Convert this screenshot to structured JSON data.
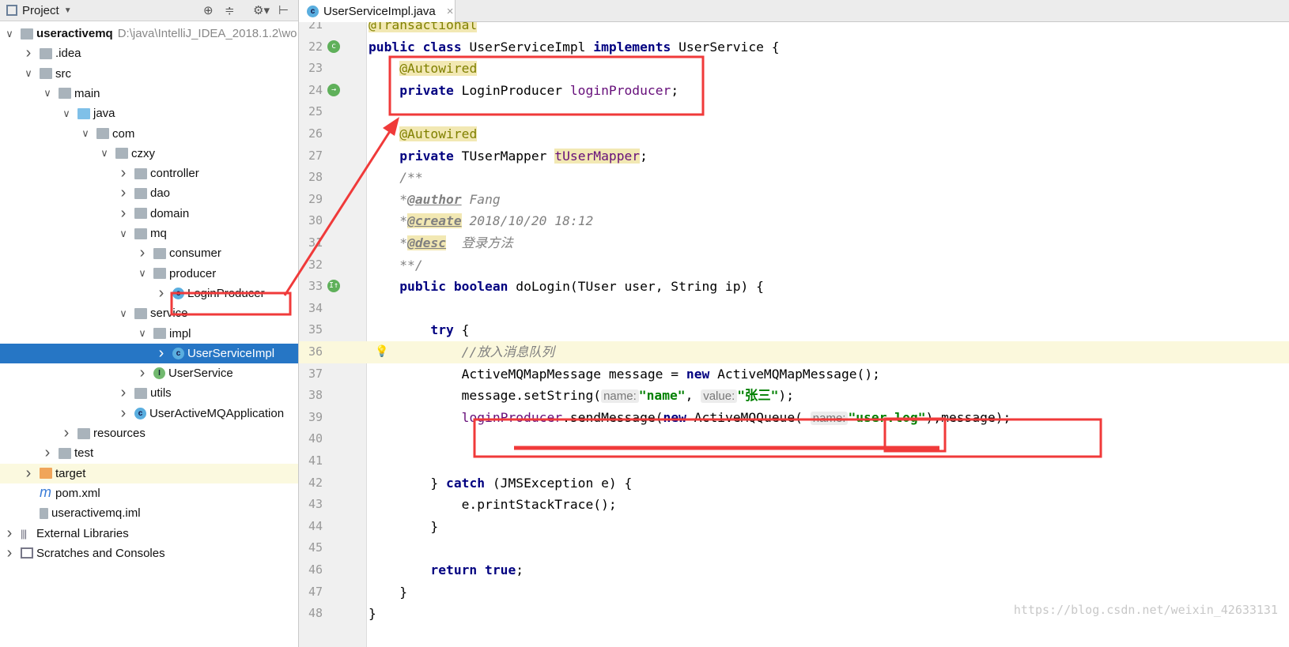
{
  "sidebar": {
    "title": "Project",
    "toolbar": [
      "locate-icon",
      "collapse-icon",
      "gear-icon",
      "hide-icon"
    ],
    "items": [
      {
        "label": "useractivemq",
        "path": "D:\\java\\IntelliJ_IDEA_2018.1.2\\wo",
        "depth": 0,
        "arrow": "open",
        "icon": "module",
        "bold": true
      },
      {
        "label": ".idea",
        "depth": 1,
        "arrow": "closed",
        "icon": "folder"
      },
      {
        "label": "src",
        "depth": 1,
        "arrow": "open",
        "icon": "folder"
      },
      {
        "label": "main",
        "depth": 2,
        "arrow": "open",
        "icon": "folder"
      },
      {
        "label": "java",
        "depth": 3,
        "arrow": "open",
        "icon": "folder-blue"
      },
      {
        "label": "com",
        "depth": 4,
        "arrow": "open",
        "icon": "package"
      },
      {
        "label": "czxy",
        "depth": 5,
        "arrow": "open",
        "icon": "package"
      },
      {
        "label": "controller",
        "depth": 6,
        "arrow": "closed",
        "icon": "package"
      },
      {
        "label": "dao",
        "depth": 6,
        "arrow": "closed",
        "icon": "package"
      },
      {
        "label": "domain",
        "depth": 6,
        "arrow": "closed",
        "icon": "package"
      },
      {
        "label": "mq",
        "depth": 6,
        "arrow": "open",
        "icon": "package"
      },
      {
        "label": "consumer",
        "depth": 7,
        "arrow": "closed",
        "icon": "package"
      },
      {
        "label": "producer",
        "depth": 7,
        "arrow": "open",
        "icon": "package"
      },
      {
        "label": "LoginProducer",
        "depth": 8,
        "arrow": "closed",
        "icon": "class"
      },
      {
        "label": "service",
        "depth": 6,
        "arrow": "open",
        "icon": "package"
      },
      {
        "label": "impl",
        "depth": 7,
        "arrow": "open",
        "icon": "package"
      },
      {
        "label": "UserServiceImpl",
        "depth": 8,
        "arrow": "closed",
        "icon": "class",
        "selected": true
      },
      {
        "label": "UserService",
        "depth": 7,
        "arrow": "closed",
        "icon": "interface"
      },
      {
        "label": "utils",
        "depth": 6,
        "arrow": "closed",
        "icon": "package"
      },
      {
        "label": "UserActiveMQApplication",
        "depth": 6,
        "arrow": "closed",
        "icon": "spring-class"
      },
      {
        "label": "resources",
        "depth": 3,
        "arrow": "closed",
        "icon": "folder"
      },
      {
        "label": "test",
        "depth": 2,
        "arrow": "closed",
        "icon": "folder"
      },
      {
        "label": "target",
        "depth": 1,
        "arrow": "closed",
        "icon": "folder-orange",
        "highlight": true
      },
      {
        "label": "pom.xml",
        "depth": 1,
        "arrow": "none",
        "icon": "maven"
      },
      {
        "label": "useractivemq.iml",
        "depth": 1,
        "arrow": "none",
        "icon": "file"
      },
      {
        "label": "External Libraries",
        "depth": 0,
        "arrow": "closed",
        "icon": "library"
      },
      {
        "label": "Scratches and Consoles",
        "depth": 0,
        "arrow": "closed",
        "icon": "scratches"
      }
    ]
  },
  "editor": {
    "tab": {
      "label": "UserServiceImpl.java",
      "icon": "class-icon",
      "close": "×"
    },
    "current_line": 36,
    "lines": [
      {
        "n": 21,
        "t": [
          [
            "an",
            "@Transactional"
          ]
        ]
      },
      {
        "n": 22,
        "g": "bean-class",
        "t": [
          [
            "kw",
            "public class "
          ],
          [
            "",
            "UserServiceImpl "
          ],
          [
            "kw",
            "implements "
          ],
          [
            "",
            "UserService {"
          ]
        ]
      },
      {
        "n": 23,
        "t": [
          [
            "",
            "    "
          ],
          [
            "an",
            "@Autowired"
          ]
        ]
      },
      {
        "n": 24,
        "g": "bean-inject",
        "t": [
          [
            "",
            "    "
          ],
          [
            "kw",
            "private "
          ],
          [
            "",
            "LoginProducer "
          ],
          [
            "fld",
            "loginProducer"
          ],
          [
            "",
            ";"
          ]
        ]
      },
      {
        "n": 25,
        "t": []
      },
      {
        "n": 26,
        "t": [
          [
            "",
            "    "
          ],
          [
            "an",
            "@Autowired"
          ]
        ]
      },
      {
        "n": 27,
        "t": [
          [
            "",
            "    "
          ],
          [
            "kw",
            "private "
          ],
          [
            "",
            "TUserMapper "
          ],
          [
            "fldh",
            "tUserMapper"
          ],
          [
            "",
            ";"
          ]
        ]
      },
      {
        "n": 28,
        "t": [
          [
            "",
            "    "
          ],
          [
            "cm",
            "/**"
          ]
        ]
      },
      {
        "n": 29,
        "t": [
          [
            "",
            "    "
          ],
          [
            "cm",
            "*"
          ],
          [
            "tag",
            "@author"
          ],
          [
            "cm",
            " Fang"
          ]
        ]
      },
      {
        "n": 30,
        "t": [
          [
            "",
            "    "
          ],
          [
            "cm",
            "*"
          ],
          [
            "tagh",
            "@create"
          ],
          [
            "cm",
            " 2018/10/20 18:12"
          ]
        ]
      },
      {
        "n": 31,
        "t": [
          [
            "",
            "    "
          ],
          [
            "cm",
            "*"
          ],
          [
            "tagh",
            "@desc"
          ],
          [
            "cm",
            "  登录方法"
          ]
        ]
      },
      {
        "n": 32,
        "t": [
          [
            "",
            "    "
          ],
          [
            "cm",
            "**/"
          ]
        ]
      },
      {
        "n": 33,
        "g": "implements-method",
        "t": [
          [
            "",
            "    "
          ],
          [
            "kw",
            "public boolean "
          ],
          [
            "",
            "doLogin(TUser user, String ip) {"
          ]
        ]
      },
      {
        "n": 34,
        "t": []
      },
      {
        "n": 35,
        "t": [
          [
            "",
            "        "
          ],
          [
            "kw",
            "try "
          ],
          [
            "",
            "{"
          ]
        ]
      },
      {
        "n": 36,
        "g": "bulb",
        "t": [
          [
            "",
            "            "
          ],
          [
            "cm",
            "//放入消息队列"
          ]
        ]
      },
      {
        "n": 37,
        "t": [
          [
            "",
            "            ActiveMQMapMessage message = "
          ],
          [
            "kw",
            "new "
          ],
          [
            "",
            "ActiveMQMapMessage();"
          ]
        ]
      },
      {
        "n": 38,
        "t": [
          [
            "",
            "            message.setString("
          ],
          [
            "hint",
            "name:"
          ],
          [
            "str",
            "\"name\""
          ],
          [
            "",
            ", "
          ],
          [
            "hint",
            "value:"
          ],
          [
            "str",
            "\"张三\""
          ],
          [
            "",
            ");"
          ]
        ]
      },
      {
        "n": 39,
        "t": [
          [
            "",
            "            "
          ],
          [
            "fld",
            "loginProducer"
          ],
          [
            "",
            ".sendMessage("
          ],
          [
            "kw",
            "new "
          ],
          [
            "",
            "ActiveMQQueue( "
          ],
          [
            "hint",
            "name:"
          ],
          [
            "str",
            "\"user.log\""
          ],
          [
            "",
            "),message);"
          ]
        ]
      },
      {
        "n": 40,
        "t": []
      },
      {
        "n": 41,
        "t": []
      },
      {
        "n": 42,
        "t": [
          [
            "",
            "        } "
          ],
          [
            "kw",
            "catch "
          ],
          [
            "",
            "(JMSException e) {"
          ]
        ]
      },
      {
        "n": 43,
        "t": [
          [
            "",
            "            e.printStackTrace();"
          ]
        ]
      },
      {
        "n": 44,
        "t": [
          [
            "",
            "        }"
          ]
        ]
      },
      {
        "n": 45,
        "t": []
      },
      {
        "n": 46,
        "t": [
          [
            "",
            "        "
          ],
          [
            "kw",
            "return true"
          ],
          [
            "",
            ";"
          ]
        ]
      },
      {
        "n": 47,
        "t": [
          [
            "",
            "    }"
          ]
        ]
      },
      {
        "n": 48,
        "t": [
          [
            "",
            "}"
          ]
        ]
      }
    ]
  },
  "watermark": "https://blog.csdn.net/weixin_42633131",
  "colors": {
    "annotation_red": "#f03a3a",
    "selection": "#2676c5",
    "keyword": "#000080",
    "string": "#008000"
  }
}
